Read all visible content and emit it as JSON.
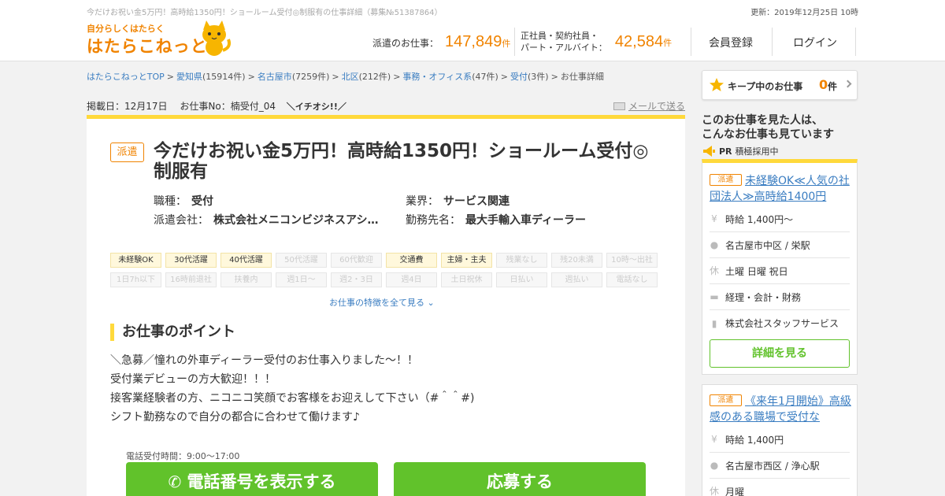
{
  "header": {
    "caption": "今だけお祝い金5万円！高時給1350円！ショールーム受付◎制服有の仕事詳細（募集№51387864）",
    "updated": "更新：2019年12月25日 10時",
    "logo_small": "自分らしくはたらく",
    "logo_big": "はたらこねっと",
    "stats": [
      {
        "label": "派遣のお仕事：",
        "value": "147,849",
        "unit": "件"
      },
      {
        "label_line1": "正社員・契約社員・",
        "label_line2": "パート・アルバイト：",
        "value": "42,584",
        "unit": "件"
      }
    ],
    "nav": {
      "register": "会員登録",
      "login": "ログイン"
    },
    "accent": "#f08300"
  },
  "breadcrumb": [
    {
      "text": "はたらこねっとTOP",
      "link": true
    },
    {
      "text": "愛知県",
      "count": "(15914件)",
      "link": true
    },
    {
      "text": "名古屋市",
      "count": "(7259件)",
      "link": true
    },
    {
      "text": "北区",
      "count": "(212件)",
      "link": true
    },
    {
      "text": "事務・オフィス系",
      "count": "(47件)",
      "link": true
    },
    {
      "text": "受付",
      "count": "(3件)",
      "link": true
    },
    {
      "text": "お仕事詳細",
      "link": false
    }
  ],
  "meta": {
    "posted": "掲載日：12月17日",
    "job_no": "お仕事No：楠受付_04",
    "ichioshi": "＼イチオシ!!／",
    "mail_link": "メールで送る"
  },
  "job": {
    "badge": "派遣",
    "title": "今だけお祝い金5万円！高時給1350円！ショールーム受付◎制服有",
    "info": [
      {
        "key": "職種：",
        "value": "受付"
      },
      {
        "key": "業界：",
        "value": "サービス関連"
      },
      {
        "key": "派遣会社：",
        "value": "株式会社メニコンビジネスアシ…"
      },
      {
        "key": "勤務先名：",
        "value": "最大手輸入車ディーラー"
      }
    ],
    "tags": [
      {
        "label": "未経験OK",
        "on": true
      },
      {
        "label": "30代活躍",
        "on": true
      },
      {
        "label": "40代活躍",
        "on": true
      },
      {
        "label": "50代活躍",
        "on": false
      },
      {
        "label": "60代歓迎",
        "on": false
      },
      {
        "label": "交通費",
        "on": true
      },
      {
        "label": "主婦・主夫",
        "on": true
      },
      {
        "label": "残業なし",
        "on": false
      },
      {
        "label": "残20未満",
        "on": false
      },
      {
        "label": "10時～出社",
        "on": false
      },
      {
        "label": "1日7h以下",
        "on": false
      },
      {
        "label": "16時前退社",
        "on": false
      },
      {
        "label": "扶養内",
        "on": false
      },
      {
        "label": "週1日～",
        "on": false
      },
      {
        "label": "週2・3日",
        "on": false
      },
      {
        "label": "週4日",
        "on": false
      },
      {
        "label": "土日祝休",
        "on": false
      },
      {
        "label": "日払い",
        "on": false
      },
      {
        "label": "週払い",
        "on": false
      },
      {
        "label": "電話なし",
        "on": false
      }
    ],
    "features_link": "お仕事の特徴を全て見る",
    "point_heading": "お仕事のポイント",
    "point_lines": [
      "＼急募／憧れの外車ディーラー受付のお仕事入りました～！！",
      "受付業デビューの方大歓迎！！！",
      "接客業経験者の方、ニコニコ笑顔でお客様をお迎えして下さい（#＾＾#)",
      "シフト勤務なので自分の都合に合わせて働けます♪"
    ],
    "tel_hours": "電話受付時間：9:00～17:00",
    "tel_button": "電話番号を表示する",
    "apply_button": "応募する"
  },
  "sidebar": {
    "keep": {
      "label": "キープ中のお仕事",
      "count": "0",
      "unit": "件"
    },
    "heading_line1": "このお仕事を見た人は、",
    "heading_line2": "こんなお仕事も見ています",
    "pr": "PR",
    "pr_text": "積極採用中",
    "cards": [
      {
        "badge": "派遣",
        "title": "未経験OK≪人気の社団法人≫高時給1400円",
        "wage": "時給 1,400円～",
        "location": "名古屋市中区 / 栄駅",
        "holidays": "土曜 日曜 祝日",
        "category": "経理・会計・財務",
        "company": "株式会社スタッフサービス",
        "detail_button": "詳細を見る"
      },
      {
        "badge": "派遣",
        "title": "《来年1月開始》高級感のある職場で受付な",
        "wage": "時給 1,400円",
        "location": "名古屋市西区 / 浄心駅",
        "holidays": "月曜"
      }
    ]
  }
}
